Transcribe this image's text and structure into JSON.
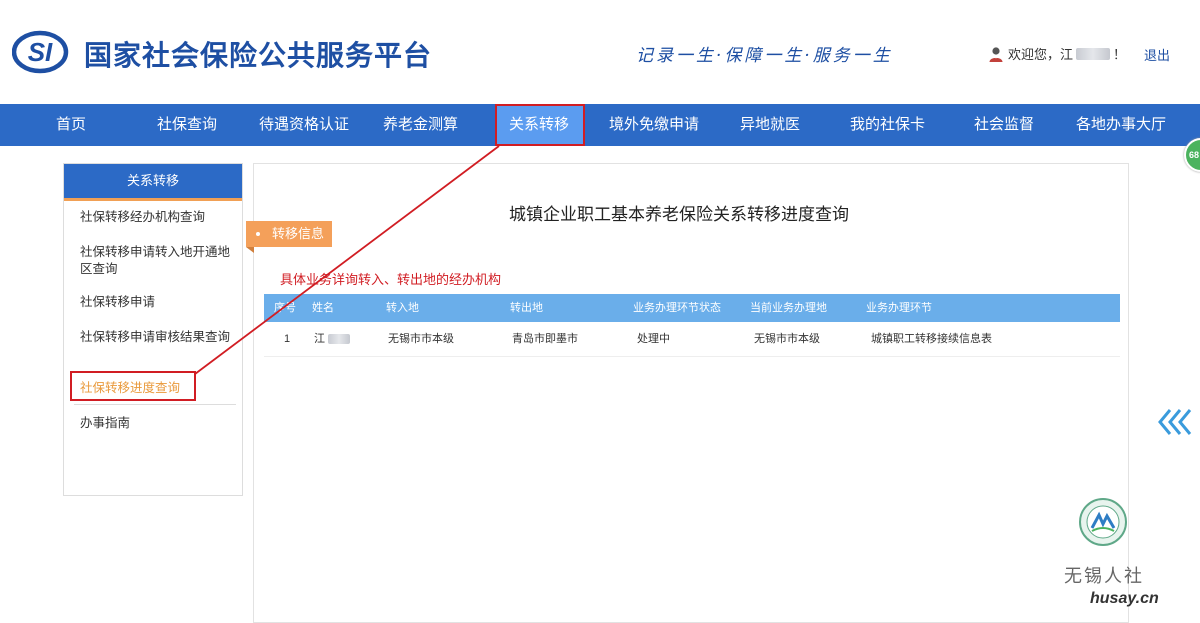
{
  "header": {
    "logo_text": "SI",
    "site_title": "国家社会保险公共服务平台",
    "slogan": "记录一生·保障一生·服务一生",
    "welcome_prefix": "欢迎您，江",
    "welcome_suffix": "！",
    "logout_label": "退出"
  },
  "nav": {
    "items": [
      {
        "label": "首页"
      },
      {
        "label": "社保查询"
      },
      {
        "label": "待遇资格认证"
      },
      {
        "label": "养老金测算"
      },
      {
        "label": "关系转移"
      },
      {
        "label": "境外免缴申请"
      },
      {
        "label": "异地就医"
      },
      {
        "label": "我的社保卡"
      },
      {
        "label": "社会监督"
      },
      {
        "label": "各地办事大厅"
      }
    ],
    "active": "关系转移"
  },
  "sidebar": {
    "title": "关系转移",
    "items": [
      {
        "label": "社保转移经办机构查询"
      },
      {
        "label": "社保转移申请转入地开通地区查询"
      },
      {
        "label": "社保转移申请"
      },
      {
        "label": "社保转移申请审核结果查询"
      },
      {
        "label": "社保转移进度查询"
      },
      {
        "label": "办事指南"
      }
    ],
    "active": "社保转移进度查询"
  },
  "main": {
    "title": "城镇企业职工基本养老保险关系转移进度查询",
    "tag_label": "转移信息",
    "note": "具体业务详询转入、转出地的经办机构",
    "table": {
      "headers": [
        "序号",
        "姓名",
        "转入地",
        "转出地",
        "业务办理环节状态",
        "当前业务办理地",
        "业务办理环节"
      ],
      "rows": [
        {
          "index": "1",
          "name": "江",
          "to": "无锡市市本级",
          "from": "青岛市即墨市",
          "status": "处理中",
          "current_place": "无锡市市本级",
          "step": "城镇职工转移接续信息表"
        }
      ]
    }
  },
  "widgets": {
    "badge_text": "68"
  },
  "watermark": {
    "account": "无锡人社",
    "site": "husay.cn"
  },
  "colors": {
    "brand_blue": "#2c6ac6",
    "title_blue": "#1e4fa3",
    "active_nav": "#5b9cf0",
    "table_header": "#6aaeea",
    "accent_orange": "#f4a05a",
    "highlight_red": "#d11d23",
    "note_red": "#d11d23"
  }
}
